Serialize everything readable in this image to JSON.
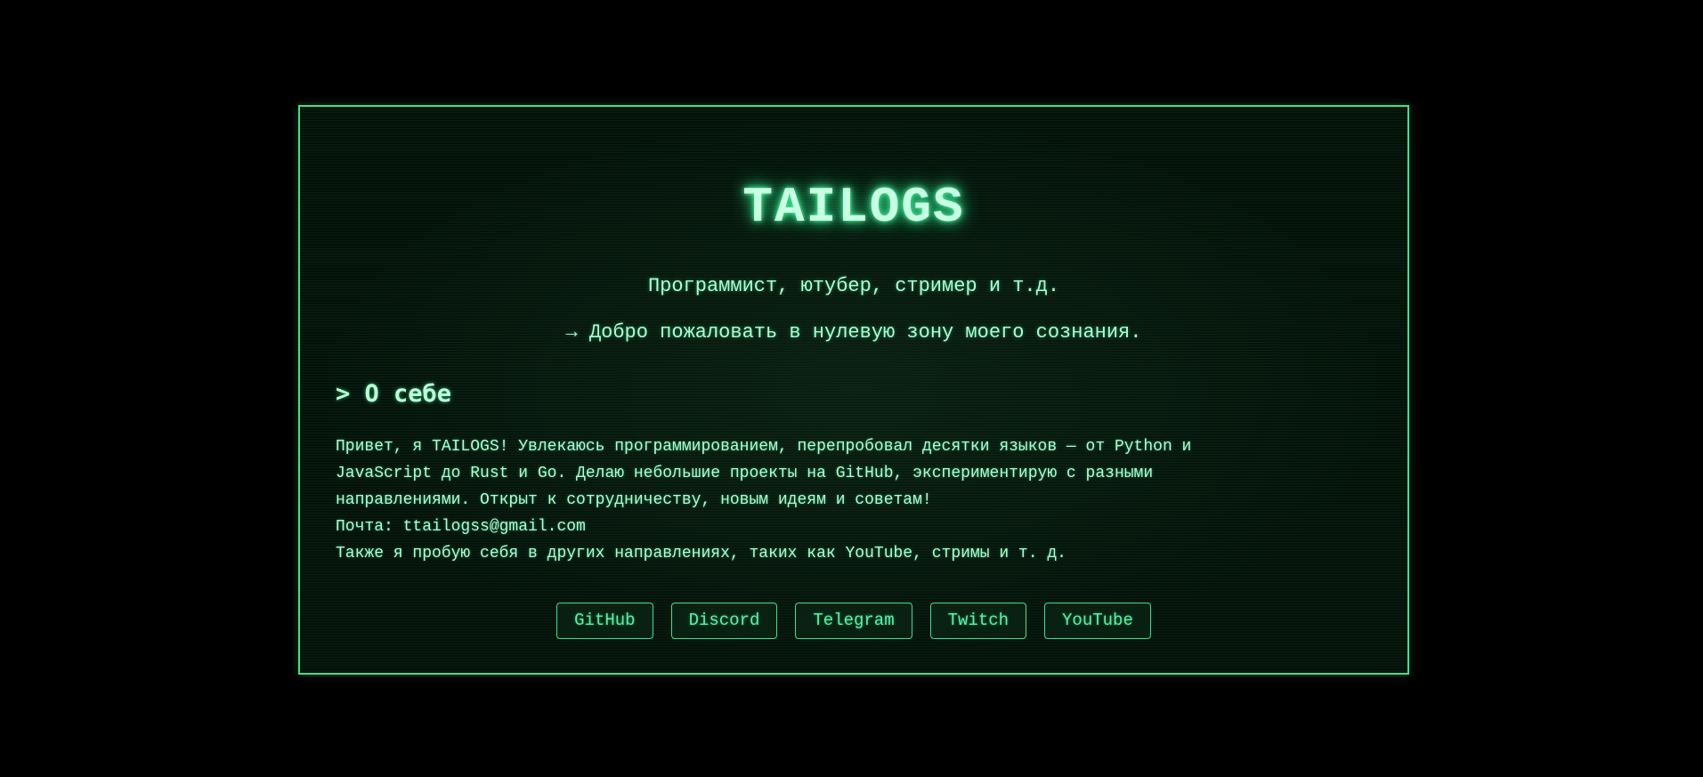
{
  "header": {
    "title": "TAILOGS",
    "subtitle": "Программист, ютубер, стример и т.д.",
    "welcome": "→ Добро пожаловать в нулевую зону моего сознания."
  },
  "about": {
    "heading": "> О себе",
    "intro_line1": "Привет, я TAILOGS! Увлекаюсь программированием, перепробовал десятки языков — от Python и",
    "intro_line2": "JavaScript до Rust и Go. Делаю небольшие проекты на GitHub, экспериментирую с разными",
    "intro_line3": "направлениями. Открыт к сотрудничеству, новым идеям и советам!",
    "email": "Почта: ttailogss@gmail.com",
    "other": "Также я пробую себя в других направлениях, таких как YouTube, стримы и т. д."
  },
  "links": [
    {
      "label": "GitHub"
    },
    {
      "label": "Discord"
    },
    {
      "label": "Telegram"
    },
    {
      "label": "Twitch"
    },
    {
      "label": "YouTube"
    }
  ],
  "colors": {
    "background": "#000000",
    "accent": "#3fe08f",
    "text": "#a9ffd2",
    "title_glow": "#4dffa3"
  }
}
